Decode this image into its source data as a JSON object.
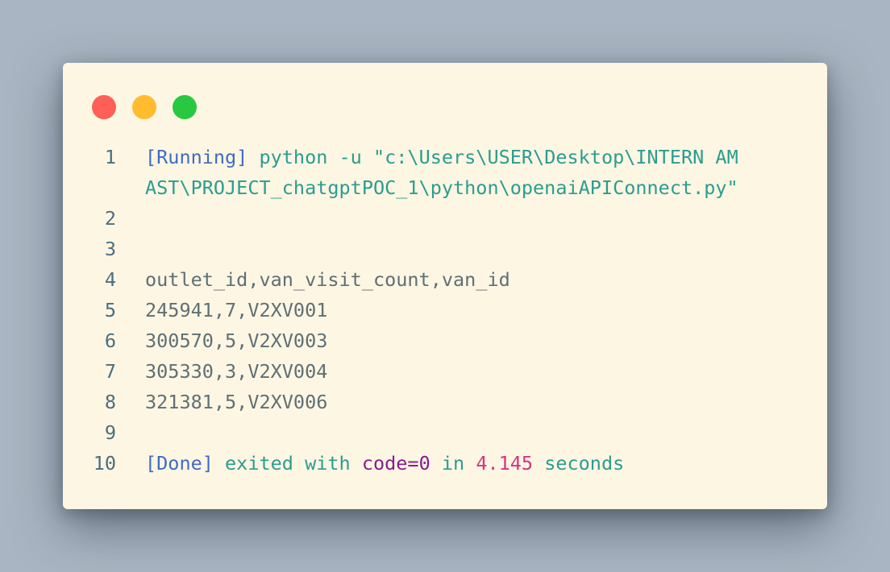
{
  "window": {
    "controls": {
      "close_color": "#ff5f57",
      "minimize_color": "#febc2e",
      "maximize_color": "#28c840"
    }
  },
  "output": {
    "line_numbers": [
      "1",
      "2",
      "3",
      "4",
      "5",
      "6",
      "7",
      "8",
      "9",
      "10"
    ],
    "running_tag": "[Running]",
    "command_part1": " python -u \"c:\\Users\\USER\\Desktop\\INTERN AM",
    "command_part2": "AST\\PROJECT_chatgptPOC_1\\python\\openaiAPIConnect.py\"",
    "csv_lines": [
      "outlet_id,van_visit_count,van_id",
      "245941,7,V2XV001",
      "300570,5,V2XV003",
      "305330,3,V2XV004",
      "321381,5,V2XV006"
    ],
    "done_tag": "[Done]",
    "exited_text": " exited with ",
    "code_text": "code=0",
    "in_text": " in ",
    "duration_text": "4.145",
    "seconds_text": " seconds"
  }
}
